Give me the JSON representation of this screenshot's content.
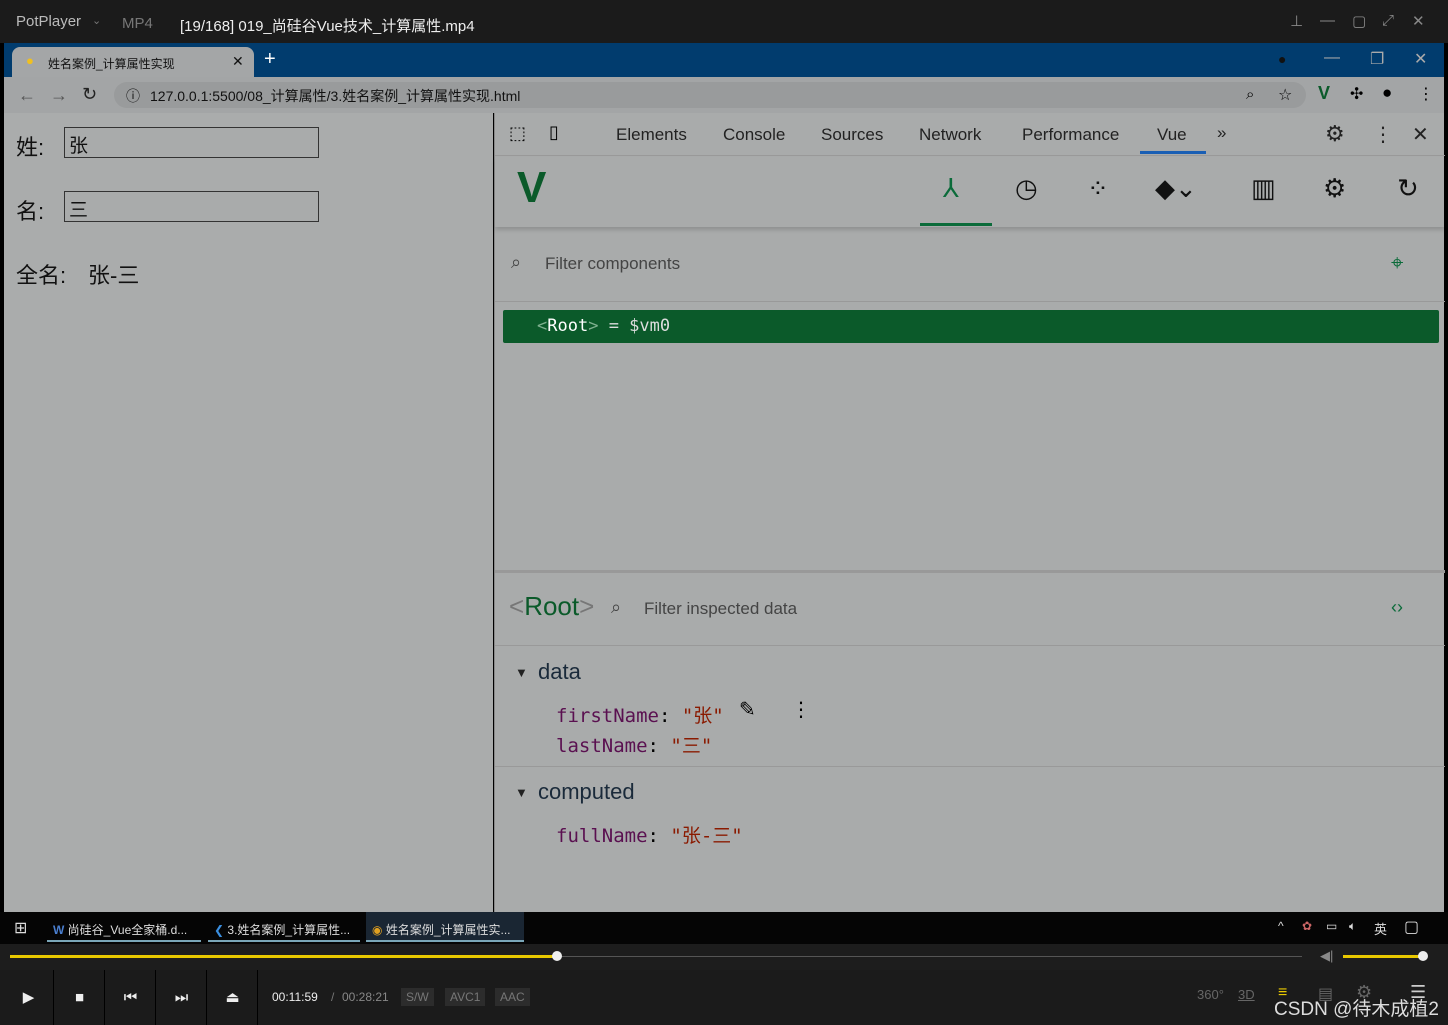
{
  "player": {
    "brand": "PotPlayer",
    "format": "MP4",
    "title": "[19/168] 019_尚硅谷Vue技术_计算属性.mp4",
    "current_time": "00:11:59",
    "separator": "/",
    "total_time": "00:28:21",
    "badges": [
      "S/W",
      "AVC1",
      "AAC"
    ],
    "progress_percent": 42.3,
    "volume_percent": 100,
    "right_icons": [
      "360°",
      "3D"
    ]
  },
  "browser": {
    "tab_title": "姓名案例_计算属性实现",
    "url": "127.0.0.1:5500/08_计算属性/3.姓名案例_计算属性实现.html"
  },
  "page": {
    "last_label": "姓:",
    "last_value": "张",
    "first_label": "名:",
    "first_value": "三",
    "full_label": "全名:",
    "full_value": "张-三"
  },
  "devtools": {
    "tabs": [
      "Elements",
      "Console",
      "Sources",
      "Network",
      "Performance",
      "Vue"
    ],
    "active_tab": "Vue",
    "filter_placeholder": "Filter components",
    "root_tag": "Root",
    "root_suffix": "= $vm0",
    "inspected_name": "Root",
    "inspect_placeholder": "Filter inspected data",
    "sections": [
      {
        "title": "data",
        "rows": [
          {
            "key": "firstName",
            "value": "\"张\""
          },
          {
            "key": "lastName",
            "value": "\"三\""
          }
        ]
      },
      {
        "title": "computed",
        "rows": [
          {
            "key": "fullName",
            "value": "\"张-三\""
          }
        ]
      }
    ],
    "accent": "#0b5a2a"
  },
  "taskbar": {
    "items": [
      "尚硅谷_Vue全家桶.d...",
      "3.姓名案例_计算属性...",
      "姓名案例_计算属性实..."
    ],
    "ime": "英"
  },
  "watermark": "CSDN @待木成植2"
}
